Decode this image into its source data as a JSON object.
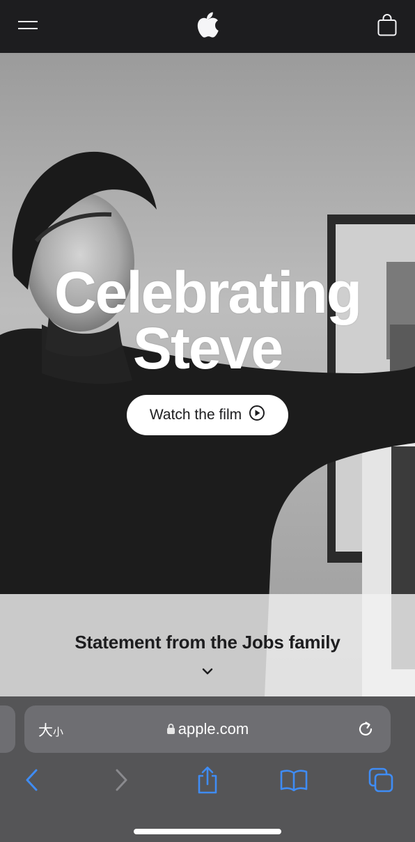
{
  "nav": {
    "menu_icon": "hamburger-icon",
    "logo_icon": "apple-logo-icon",
    "bag_icon": "shopping-bag-icon"
  },
  "hero": {
    "title_line1": "Celebrating",
    "title_line2": "Steve",
    "cta_label": "Watch the film",
    "cta_icon": "play-circle-icon"
  },
  "statement": {
    "text": "Statement from the Jobs family",
    "icon": "chevron-down-icon"
  },
  "safari": {
    "aa_large": "大",
    "aa_small": "小",
    "url": "apple.com",
    "lock_icon": "lock-icon",
    "reload_icon": "reload-icon",
    "toolbar": [
      "back-icon",
      "forward-icon",
      "share-icon",
      "bookmarks-icon",
      "tabs-icon"
    ]
  },
  "colors": {
    "nav_bg": "#1d1d1f",
    "safari_bg": "#555557",
    "safari_accent": "#3f8cf5",
    "disabled": "#8a8a8e"
  }
}
